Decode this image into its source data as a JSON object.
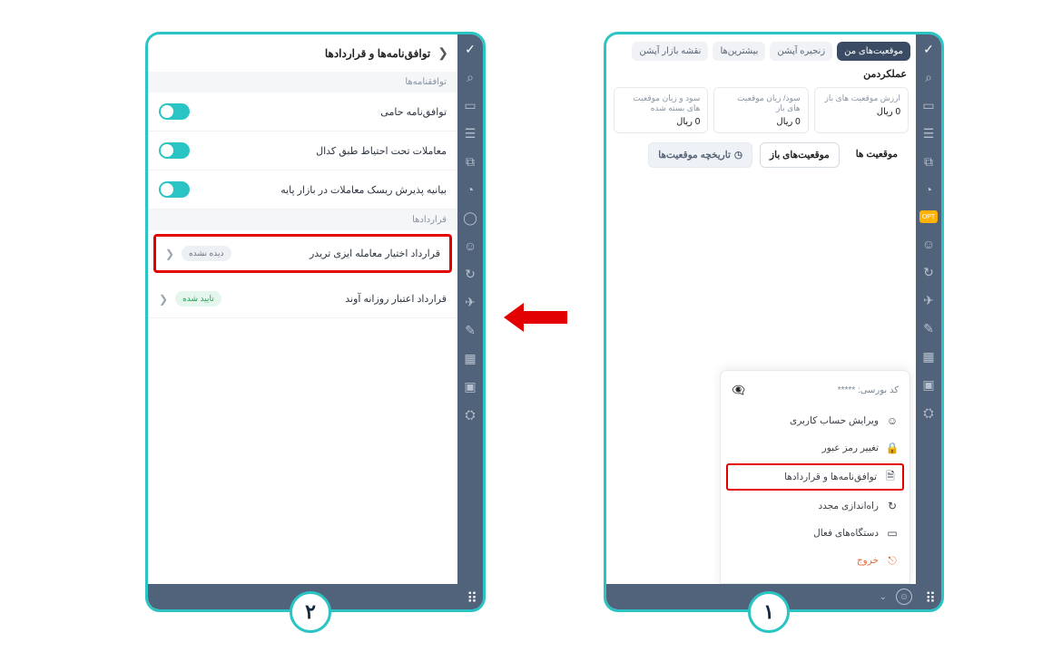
{
  "steps": {
    "one": "۱",
    "two": "۲"
  },
  "frame1": {
    "tabs": {
      "my_positions": "موقعیت‌های من",
      "option_chain": "زنجیره آپشن",
      "most": "بیشترین‌ها",
      "market_map": "نقشه بازار آپشن"
    },
    "performance_title": "عملکردمن",
    "stats": {
      "open_value_label": "ارزش موقعیت های باز",
      "open_value": "0 ریال",
      "open_pl_label": "سود/ زیان موقعیت های باز",
      "open_pl": "0 ریال",
      "closed_pl_label": "سود و زیان موقعیت های بسته شده",
      "closed_pl": "0 ریال"
    },
    "pos_tabs": {
      "list": "موقعیت ها",
      "open": "موقعیت‌های باز",
      "history": "تاریخچه موقعیت‌ها"
    },
    "profile": {
      "code_label": "کد بورسی:",
      "code_masked": "*****",
      "items": {
        "edit_account": "ویرایش حساب کاربری",
        "change_password": "تغییر رمز عبور",
        "agreements": "توافق‌نامه‌ها و قراردادها",
        "restart": "راه‌اندازی مجدد",
        "active_devices": "دستگاه‌های فعال",
        "logout": "خروج"
      }
    }
  },
  "frame2": {
    "title": "توافق‌نامه‌ها و قراردادها",
    "sections": {
      "agreements": "توافقنامه‌ها",
      "contracts": "قراردادها"
    },
    "agreements": {
      "sponsor": "توافق‌نامه حامی",
      "codal": "معاملات تحت احتیاط طبق کدال",
      "risk": "بیانیه پذیرش ریسک معاملات در بازار پایه"
    },
    "contracts": {
      "easytrader": "قرارداد اختیار معامله ایزی تریدر",
      "avand": "قرارداد اعتبار روزانه آوند"
    },
    "badges": {
      "unseen": "دیده نشده",
      "approved": "تایید شده"
    }
  },
  "sidebar_opt": "OPT"
}
